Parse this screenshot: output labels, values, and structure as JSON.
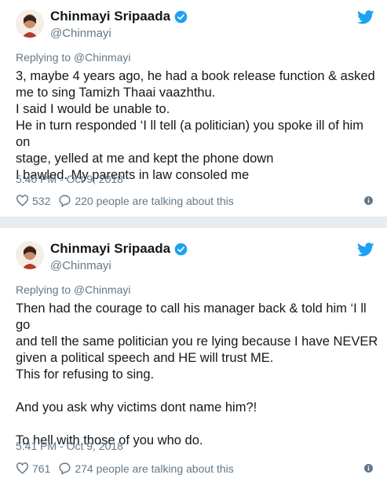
{
  "tweets": [
    {
      "name": "Chinmayi Sripaada",
      "handle": "@Chinmayi",
      "replying_to": "Replying to @Chinmayi",
      "lines": [
        "3, maybe 4 years ago, he had a book release function & asked",
        "me to sing Tamizh Thaai vaazhthu.",
        "I said I would be unable to.",
        "He in turn responded ‘I ll tell (a politician) you spoke ill of him on",
        "stage, yelled at me and kept the phone down",
        "I bawled. My parents in law consoled me"
      ],
      "timestamp": "5:40 PM - Oct 9, 2018",
      "likes": "532",
      "talking": "220 people are talking about this"
    },
    {
      "name": "Chinmayi Sripaada",
      "handle": "@Chinmayi",
      "replying_to": "Replying to @Chinmayi",
      "lines": [
        "Then had the courage to call his manager back & told him ‘I ll go",
        "and tell the same politician you re lying because I have NEVER",
        "given a political speech and HE will trust ME.",
        "This for refusing to sing.",
        "",
        "And you ask why victims dont name him?!",
        "",
        "To hell with those of you who do."
      ],
      "timestamp": "5:41 PM - Oct 9, 2018",
      "likes": "761",
      "talking": "274 people are talking about this"
    }
  ],
  "icons": {
    "verified": "verified-badge-icon",
    "bird": "twitter-bird-icon",
    "like": "heart-icon",
    "reply": "speech-bubble-icon",
    "info": "info-icon"
  },
  "colors": {
    "twitter_blue": "#1da1f2",
    "text": "#14171a",
    "secondary": "#657786",
    "divider": "#e6ecf0"
  }
}
